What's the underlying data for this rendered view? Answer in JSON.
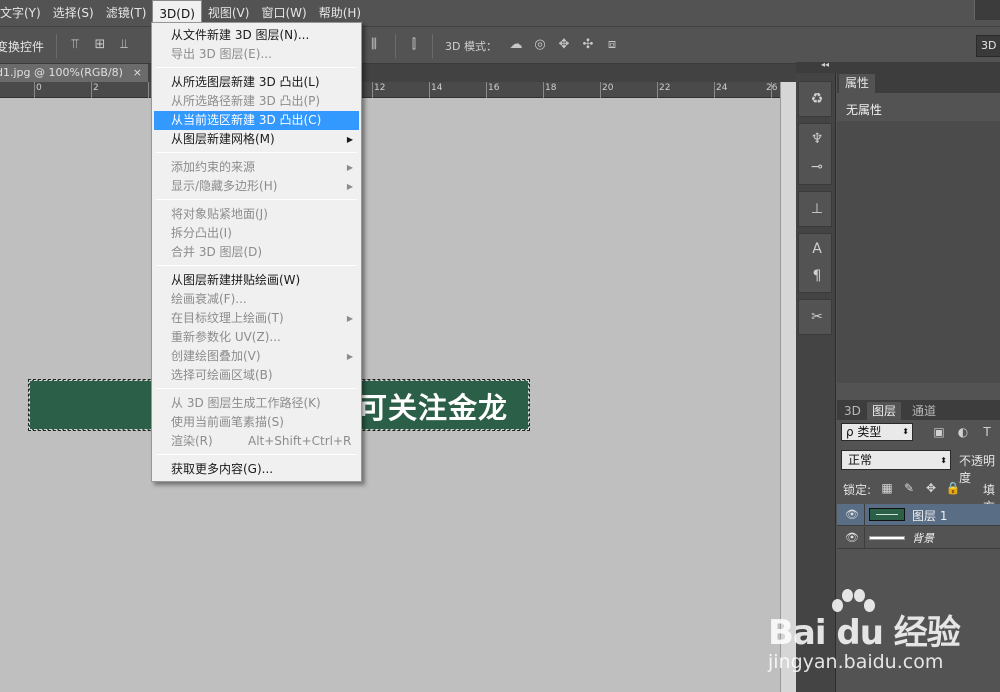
{
  "menubar": {
    "items": [
      "文字(Y)",
      "选择(S)",
      "滤镜(T)",
      "3D(D)",
      "视图(V)",
      "窗口(W)",
      "帮助(H)"
    ],
    "active_index": 3
  },
  "options": {
    "transform_controls": "变换控件",
    "mode_label": "3D 模式：",
    "button_3d": "3D"
  },
  "document": {
    "tab_title": "d1.jpg @ 100%(RGB/8)",
    "close_glyph": "×",
    "ruler_numbers": [
      "0",
      "2",
      "12",
      "14",
      "16",
      "18",
      "20",
      "22",
      "24",
      "26"
    ]
  },
  "canvas": {
    "banner_color": "#2c5f47",
    "banner_text": "可关注金龙"
  },
  "dropdown": {
    "items": [
      {
        "label": "从文件新建 3D 图层(N)...",
        "enabled": true
      },
      {
        "label": "导出 3D 图层(E)...",
        "enabled": false
      },
      {
        "label": "从所选图层新建 3D 凸出(L)",
        "enabled": true
      },
      {
        "label": "从所选路径新建 3D 凸出(P)",
        "enabled": false
      },
      {
        "label": "从当前选区新建 3D 凸出(C)",
        "enabled": true,
        "highlighted": true
      },
      {
        "label": "从图层新建网格(M)",
        "enabled": true,
        "submenu": true
      },
      {
        "label": "添加约束的来源",
        "enabled": false,
        "submenu": true
      },
      {
        "label": "显示/隐藏多边形(H)",
        "enabled": false,
        "submenu": true
      },
      {
        "label": "将对象贴紧地面(J)",
        "enabled": false
      },
      {
        "label": "拆分凸出(I)",
        "enabled": false
      },
      {
        "label": "合并 3D 图层(D)",
        "enabled": false
      },
      {
        "label": "从图层新建拼贴绘画(W)",
        "enabled": true
      },
      {
        "label": "绘画衰减(F)...",
        "enabled": false
      },
      {
        "label": "在目标纹理上绘画(T)",
        "enabled": false,
        "submenu": true
      },
      {
        "label": "重新参数化 UV(Z)...",
        "enabled": false
      },
      {
        "label": "创建绘图叠加(V)",
        "enabled": false,
        "submenu": true
      },
      {
        "label": "选择可绘画区域(B)",
        "enabled": false
      },
      {
        "label": "从 3D 图层生成工作路径(K)",
        "enabled": false
      },
      {
        "label": "使用当前画笔素描(S)",
        "enabled": false
      },
      {
        "label": "渲染(R)",
        "enabled": false,
        "shortcut": "Alt+Shift+Ctrl+R"
      },
      {
        "label": "获取更多内容(G)...",
        "enabled": true
      }
    ],
    "submenu_glyph": "▶",
    "highlight_color": "#3399ff"
  },
  "panels": {
    "collapse_glyph": "◂◂",
    "properties": {
      "tab": "属性",
      "content": "无属性"
    },
    "layers": {
      "tabs": [
        "3D",
        "图层",
        "通道"
      ],
      "active_tab": 1,
      "filter_kind": "ρ 类型",
      "blend_mode": "正常",
      "opacity_label": "不透明度",
      "lock_label": "锁定:",
      "fill_label": "填充",
      "rows": [
        {
          "name": "图层 1",
          "selected": true,
          "thumb": "green"
        },
        {
          "name": "背景",
          "selected": false,
          "thumb": "white"
        }
      ],
      "eye_glyph": "👁"
    }
  },
  "watermark": {
    "brand": "Bai du 经验",
    "url": "jingyan.baidu.com"
  }
}
